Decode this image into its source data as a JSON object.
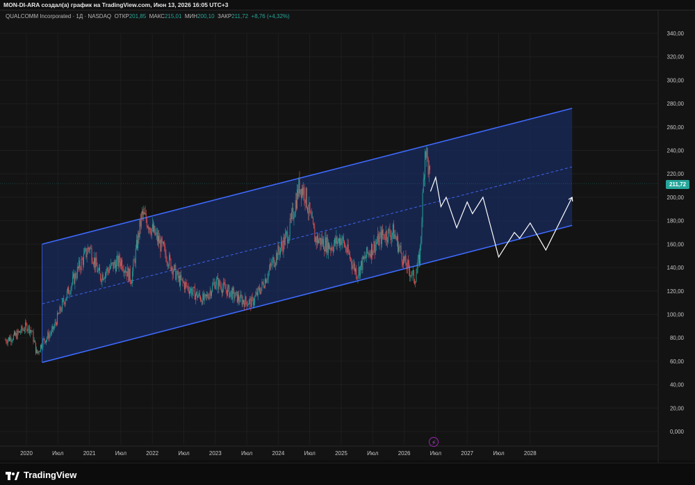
{
  "header": {
    "caption": "MON-DI-ARA создал(а) график на TradingView.com, Июн 13, 2026 16:05 UTC+3"
  },
  "legend": {
    "symbol": "QUALCOMM Incorporated · 1Д · NASDAQ",
    "open_label": "ОТКР",
    "open_value": "201,85",
    "high_label": "МАКС",
    "high_value": "215,01",
    "low_label": "МИН",
    "low_value": "200,10",
    "close_label": "ЗАКР",
    "close_value": "211,72",
    "change": "+8,76 (+4,32%)"
  },
  "last_price": "211,72",
  "footer": {
    "brand": "TradingView"
  },
  "icons": {
    "logo": "tradingview-logo-icon",
    "event": "lightning-icon"
  },
  "colors": {
    "up": "#26a69a",
    "down": "#ef5350",
    "channel": "#3d6bff",
    "channel_fill": "#1a2b5e",
    "projection": "#ffffff",
    "background": "#131313"
  },
  "chart_data": {
    "type": "candlestick",
    "ylim": [
      0,
      340
    ],
    "y_ticks": [
      "340,00",
      "320,00",
      "300,00",
      "280,00",
      "260,00",
      "240,00",
      "220,00",
      "200,00",
      "180,00",
      "160,00",
      "140,00",
      "120,00",
      "100,00",
      "80,00",
      "60,00",
      "40,00",
      "20,00",
      "0,000"
    ],
    "x_ticks": [
      "2020",
      "Июл",
      "2021",
      "Июл",
      "2022",
      "Июл",
      "2023",
      "Июл",
      "2024",
      "Июл",
      "2025",
      "Июл",
      "2026",
      "Июл",
      "2027",
      "Июл",
      "2028"
    ],
    "price_path": [
      [
        "2019-09",
        78
      ],
      [
        "2019-11",
        82
      ],
      [
        "2020-01",
        90
      ],
      [
        "2020-02",
        86
      ],
      [
        "2020-03",
        66
      ],
      [
        "2020-04",
        76
      ],
      [
        "2020-06",
        86
      ],
      [
        "2020-08",
        110
      ],
      [
        "2020-11",
        140
      ],
      [
        "2021-01",
        158
      ],
      [
        "2021-03",
        132
      ],
      [
        "2021-05",
        140
      ],
      [
        "2021-07",
        146
      ],
      [
        "2021-09",
        130
      ],
      [
        "2021-11",
        185
      ],
      [
        "2021-12",
        180
      ],
      [
        "2022-03",
        156
      ],
      [
        "2022-06",
        130
      ],
      [
        "2022-09",
        118
      ],
      [
        "2022-11",
        112
      ],
      [
        "2023-01",
        128
      ],
      [
        "2023-04",
        118
      ],
      [
        "2023-06",
        112
      ],
      [
        "2023-08",
        110
      ],
      [
        "2023-10",
        125
      ],
      [
        "2023-12",
        145
      ],
      [
        "2024-03",
        170
      ],
      [
        "2024-05",
        210
      ],
      [
        "2024-06",
        205
      ],
      [
        "2024-08",
        165
      ],
      [
        "2024-11",
        158
      ],
      [
        "2025-01",
        165
      ],
      [
        "2025-04",
        135
      ],
      [
        "2025-06",
        152
      ],
      [
        "2025-09",
        168
      ],
      [
        "2025-11",
        170
      ],
      [
        "2026-01",
        145
      ],
      [
        "2026-03",
        130
      ],
      [
        "2026-04",
        150
      ],
      [
        "2026-05",
        245
      ],
      [
        "2026-06",
        211.72
      ]
    ],
    "channel": {
      "upper": [
        [
          "2020-04",
          160
        ],
        [
          "2028-09",
          276
        ]
      ],
      "middle": [
        [
          "2020-04",
          109
        ],
        [
          "2028-09",
          226
        ]
      ],
      "lower": [
        [
          "2020-04",
          59
        ],
        [
          "2028-09",
          176
        ]
      ]
    },
    "projection": [
      [
        "2026-06",
        205
      ],
      [
        "2026-07",
        217
      ],
      [
        "2026-08",
        192
      ],
      [
        "2026-09",
        200
      ],
      [
        "2026-11",
        174
      ],
      [
        "2027-01",
        196
      ],
      [
        "2027-02",
        186
      ],
      [
        "2027-04",
        200
      ],
      [
        "2027-07",
        149
      ],
      [
        "2027-10",
        170
      ],
      [
        "2027-11",
        165
      ],
      [
        "2028-01",
        178
      ],
      [
        "2028-04",
        155
      ],
      [
        "2028-09",
        200
      ]
    ]
  }
}
